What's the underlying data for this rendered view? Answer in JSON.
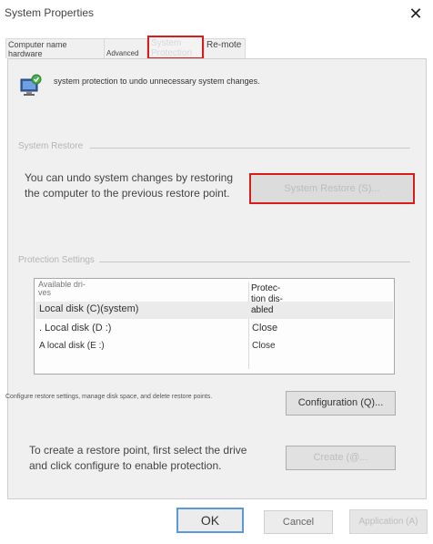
{
  "window": {
    "title": "System Properties",
    "close_glyph": "✕"
  },
  "tabs": [
    {
      "label": "Computer name hardware"
    },
    {
      "label": "Advanced"
    },
    {
      "label": "System Protection",
      "active": true
    },
    {
      "label": "Re-mote"
    }
  ],
  "intro": {
    "text": "system protection to undo unnecessary system changes.",
    "icon": "computer-shield-icon"
  },
  "system_restore": {
    "group_label": "System Restore",
    "description_line1": "You can undo system changes by restoring",
    "description_line2": "the computer to the previous restore point.",
    "button_label": "System Restore (S)..."
  },
  "protection_settings": {
    "group_label": "Protection Settings",
    "col_drive_line1": "Available dri-",
    "col_drive_line2": "ves",
    "col_protection_line1": "Protec-",
    "col_protection_line2": "tion dis-",
    "col_protection_line3": "abled",
    "rows": [
      {
        "drive": "Local disk (C)(system)",
        "status": ""
      },
      {
        "drive": ". Local disk (D :)",
        "status": "Close"
      },
      {
        "drive": "A local disk (E :)",
        "status": "Close"
      }
    ]
  },
  "configure": {
    "description": "Configure restore settings, manage disk space, and delete restore points.",
    "button_label": "Configuration (Q)..."
  },
  "create": {
    "description_line1": "To create a restore point, first select the drive",
    "description_line2": "and click configure to enable protection.",
    "button_label": "Create (@..."
  },
  "footer": {
    "ok_label": "OK",
    "cancel_label": "Cancel",
    "apply_label": "Application (A)"
  },
  "colors": {
    "highlight": "#d81b1b",
    "ok_border": "#5a9bd5",
    "panel_bg": "#f0f0f0"
  }
}
